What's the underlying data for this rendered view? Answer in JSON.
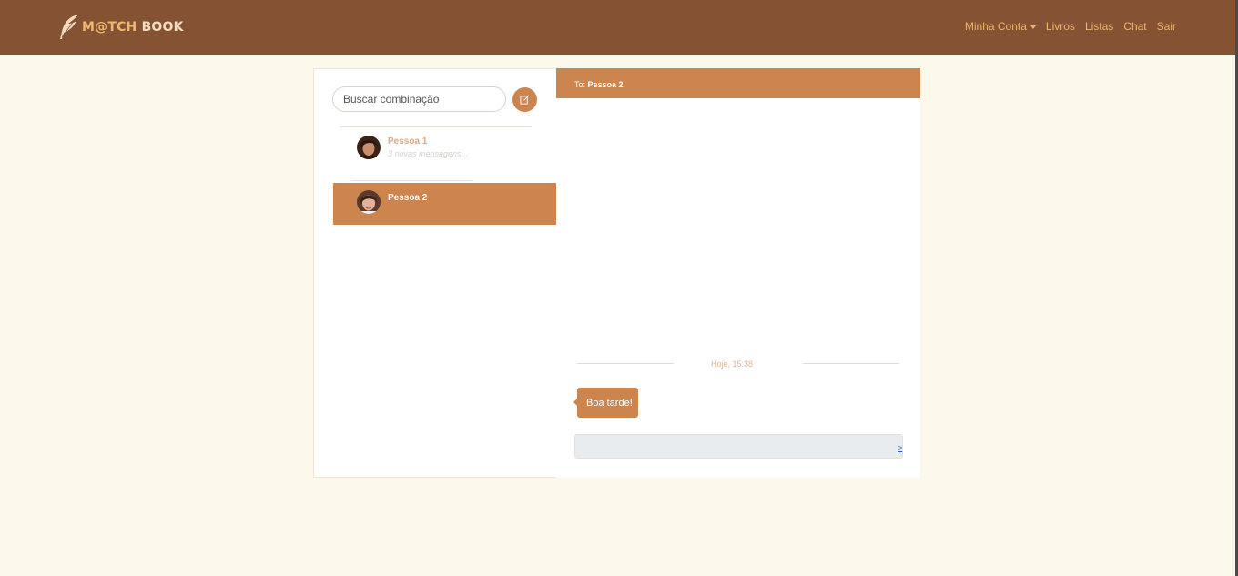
{
  "brand": {
    "part_a": "M@TCH",
    "part_b": "BOOK",
    "icon": "feather-icon"
  },
  "nav": {
    "account": "Minha Conta",
    "books": "Livros",
    "lists": "Listas",
    "chat": "Chat",
    "logout": "Sair"
  },
  "inbox": {
    "search_placeholder": "Buscar combinação",
    "search_icon": "edit-icon",
    "conversations": [
      {
        "name": "Pessoa 1",
        "preview": "3 novas mensagens..."
      },
      {
        "name": "Pessoa 2",
        "preview": ""
      }
    ]
  },
  "conversation": {
    "to_label": "To:",
    "to_name": "Pessoa 2",
    "timestamp": "Hoje, 15:38",
    "messages": [
      {
        "text": "Boa tarde!"
      }
    ],
    "send_label": ">"
  },
  "colors": {
    "navbar": "#855233",
    "accent": "#cd8550",
    "background": "#fcf9ec"
  }
}
